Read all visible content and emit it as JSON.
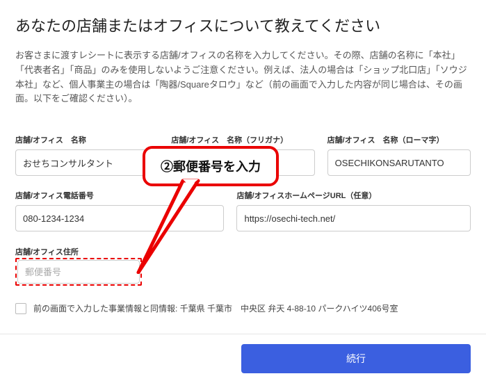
{
  "title": "あなたの店舗またはオフィスについて教えてください",
  "description": "お客さまに渡すレシートに表示する店舗/オフィスの名称を入力してください。その際、店舗の名称に「本社」「代表者名」「商品」のみを使用しないようご注意ください。例えば、法人の場合は「ショップ北口店」「ソウジ本社」など、個人事業主の場合は「陶器/Squareタロウ」など（前の画面で入力した内容が同じ場合は、その画面。以下をご確認ください）。",
  "fields": {
    "storeName": {
      "label": "店舗/オフィス　名称",
      "value": "おせちコンサルタント"
    },
    "storeNameKana": {
      "label": "店舗/オフィス　名称（フリガナ）",
      "value": ""
    },
    "storeNameRomaji": {
      "label": "店舗/オフィス　名称（ローマ字）",
      "value": "OSECHIKONSARUTANTO"
    },
    "phone": {
      "label": "店舗/オフィス電話番号",
      "value": "080-1234-1234"
    },
    "url": {
      "label": "店舗/オフィスホームページURL（任意）",
      "value": "https://osechi-tech.net/"
    },
    "address": {
      "label": "店舗/オフィス住所"
    },
    "postal": {
      "placeholder": "郵便番号",
      "value": ""
    }
  },
  "checkbox": {
    "label": "前の画面で入力した事業情報と同情報: 千葉県 千葉市　中央区 弁天 4-88-10 パークハイツ406号室"
  },
  "callout": "②郵便番号を入力",
  "continueLabel": "続行"
}
